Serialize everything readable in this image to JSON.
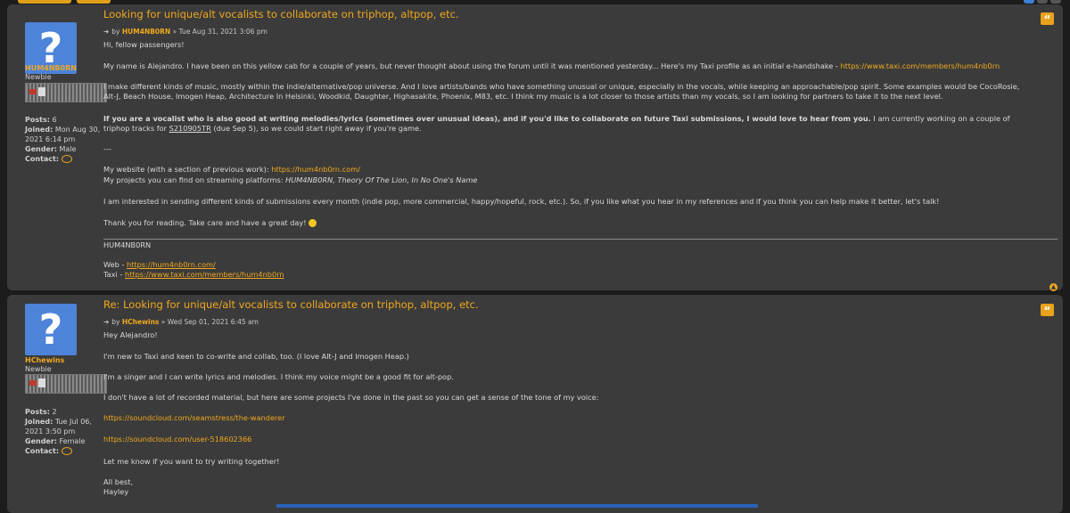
{
  "post1": {
    "title": "Looking for unique/alt vocalists to collaborate on triphop, altpop, etc.",
    "by_prefix": "by",
    "author": "HUM4NB0RN",
    "date": "» Tue Aug 31, 2021 3:06 pm",
    "profile": {
      "username": "HUM4NB0RN",
      "rank": "Newbie",
      "posts_label": "Posts:",
      "posts": "6",
      "joined_label": "Joined:",
      "joined": "Mon Aug 30, 2021 6:14 pm",
      "gender_label": "Gender:",
      "gender": "Male",
      "contact_label": "Contact:"
    },
    "greeting": "Hi, fellow passengers!",
    "p1_text": "My name is Alejandro. I have been on this yellow cab for a couple of years, but never thought about using the forum until it was mentioned yesterday... Here's my Taxi profile as an initial e-handshake - ",
    "p1_link": "https://www.taxi.com/members/hum4nb0rn",
    "p2": "I make different kinds of music, mostly within the indie/alternative/pop universe. And I love artists/bands who have something unusual or unique, especially in the vocals, while keeping an approachable/pop spirit. Some examples would be CocoRosie, Alt-J, Beach House, Imogen Heap, Architecture In Helsinki, Woodkid, Daughter, Highasakite, Phoenix, M83, etc. I think my music is a lot closer to those artists than my vocals, so I am looking for partners to take it to the next level.",
    "p3_bold": "If you are a vocalist who is also good at writing melodies/lyrics (sometimes over unusual ideas), and if you'd like to collaborate on future Taxi submissions, I would love to hear from you.",
    "p3_rest": " I am currently working on a couple of triphop tracks for ",
    "p3_code": "S210905TR",
    "p3_end": " (due Sep 5), so we could start right away if you're game.",
    "separator": "---",
    "website_text": "My website (with a section of previous work): ",
    "website_link": "https://hum4nb0rn.com/",
    "projects_text": "My projects you can find on streaming platforms: ",
    "projects_italic": "HUM4NB0RN, Theory Of The Lion, In No One's Name",
    "interest": "I am interested in sending different kinds of submissions every month (indie pop, more commercial, happy/hopeful, rock, etc.). So, if you like what you hear in my references and if you think you can help make it better, let's talk!",
    "thanks": "Thank you for reading. Take care and have a great day!",
    "sig_name": "HUM4NB0RN",
    "sig_web_label": "Web - ",
    "sig_web_link": "https://hum4nb0rn.com/",
    "sig_taxi_label": "Taxi - ",
    "sig_taxi_link": "https://www.taxi.com/members/hum4nb0rn"
  },
  "post2": {
    "title": "Re: Looking for unique/alt vocalists to collaborate on triphop, altpop, etc.",
    "by_prefix": "by",
    "author": "HChewins",
    "date": "» Wed Sep 01, 2021 6:45 am",
    "profile": {
      "username": "HChewins",
      "rank": "Newbie",
      "posts_label": "Posts:",
      "posts": "2",
      "joined_label": "Joined:",
      "joined": "Tue Jul 06, 2021 3:50 pm",
      "gender_label": "Gender:",
      "gender": "Female",
      "contact_label": "Contact:"
    },
    "greeting": "Hey Alejandro!",
    "l1": "I'm new to Taxi and keen to co-write and collab, too. (I love Alt-J and Imogen Heap.)",
    "l2": "I'm a singer and I can write lyrics and melodies. I think my voice might be a good fit for alt-pop.",
    "l3": "I don't have a lot of recorded material, but here are some projects I've done in the past so you can get a sense of the tone of my voice:",
    "link1": "https://soundcloud.com/seamstress/the-wanderer",
    "link2": "https://soundcloud.com/user-518602366",
    "l4": "Let me know if you want to try writing together!",
    "closing1": "All best,",
    "closing2": "Hayley"
  },
  "icons": {
    "quote": "quote-icon",
    "avatar": "question-mark-avatar",
    "contact": "speech-bubble-icon",
    "arrow": "arrow-right-icon",
    "top": "chevron-up-icon",
    "smiley": "smiley-icon"
  },
  "colors": {
    "accent": "#f0a81e",
    "post_bg": "#3b3b3b",
    "page_bg": "#1c1c1c",
    "avatar_bg": "#4d83d9"
  }
}
